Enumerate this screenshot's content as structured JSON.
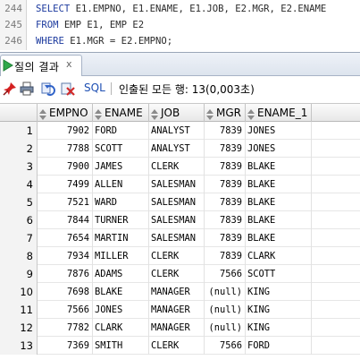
{
  "editor": {
    "lines": [
      {
        "no": "244",
        "parts": [
          {
            "t": "SELECT ",
            "c": "kw"
          },
          {
            "t": "E1.EMPNO, E1.ENAME, E1.JOB, E2.MGR, E2.ENAME",
            "c": "id"
          }
        ]
      },
      {
        "no": "245",
        "parts": [
          {
            "t": "FROM ",
            "c": "kw"
          },
          {
            "t": "EMP E1, EMP E2",
            "c": "id"
          }
        ]
      },
      {
        "no": "246",
        "parts": [
          {
            "t": "WHERE ",
            "c": "kw"
          },
          {
            "t": "E1.MGR = E2.EMPNO;",
            "c": "id"
          }
        ]
      }
    ]
  },
  "results": {
    "tab_label": "질의 결과",
    "tab_close": "x",
    "toolbar": {
      "sql_label": "SQL",
      "status_text": "인출된 모든 행: 13(0,003초)"
    },
    "columns": [
      "EMPNO",
      "ENAME",
      "JOB",
      "MGR",
      "ENAME_1"
    ],
    "rows": [
      {
        "n": "1",
        "empno": "7902",
        "ename": "FORD",
        "job": "ANALYST",
        "mgr": "7839",
        "ename_1": "JONES"
      },
      {
        "n": "2",
        "empno": "7788",
        "ename": "SCOTT",
        "job": "ANALYST",
        "mgr": "7839",
        "ename_1": "JONES"
      },
      {
        "n": "3",
        "empno": "7900",
        "ename": "JAMES",
        "job": "CLERK",
        "mgr": "7839",
        "ename_1": "BLAKE"
      },
      {
        "n": "4",
        "empno": "7499",
        "ename": "ALLEN",
        "job": "SALESMAN",
        "mgr": "7839",
        "ename_1": "BLAKE"
      },
      {
        "n": "5",
        "empno": "7521",
        "ename": "WARD",
        "job": "SALESMAN",
        "mgr": "7839",
        "ename_1": "BLAKE"
      },
      {
        "n": "6",
        "empno": "7844",
        "ename": "TURNER",
        "job": "SALESMAN",
        "mgr": "7839",
        "ename_1": "BLAKE"
      },
      {
        "n": "7",
        "empno": "7654",
        "ename": "MARTIN",
        "job": "SALESMAN",
        "mgr": "7839",
        "ename_1": "BLAKE"
      },
      {
        "n": "8",
        "empno": "7934",
        "ename": "MILLER",
        "job": "CLERK",
        "mgr": "7839",
        "ename_1": "CLARK"
      },
      {
        "n": "9",
        "empno": "7876",
        "ename": "ADAMS",
        "job": "CLERK",
        "mgr": "7566",
        "ename_1": "SCOTT"
      },
      {
        "n": "10",
        "empno": "7698",
        "ename": "BLAKE",
        "job": "MANAGER",
        "mgr": "(null)",
        "ename_1": "KING"
      },
      {
        "n": "11",
        "empno": "7566",
        "ename": "JONES",
        "job": "MANAGER",
        "mgr": "(null)",
        "ename_1": "KING"
      },
      {
        "n": "12",
        "empno": "7782",
        "ename": "CLARK",
        "job": "MANAGER",
        "mgr": "(null)",
        "ename_1": "KING"
      },
      {
        "n": "13",
        "empno": "7369",
        "ename": "SMITH",
        "job": "CLERK",
        "mgr": "7566",
        "ename_1": "FORD"
      }
    ]
  },
  "icons": {
    "tab_icon": "play-triangle-icon",
    "toolbar": [
      "pin-icon",
      "print-icon",
      "refresh-icon",
      "cancel-query-icon"
    ]
  },
  "colors": {
    "keyword": "#1c3a9e",
    "tab_icon": "#2fa84a",
    "sql_link": "#1e4fb3",
    "pin": "#d42020"
  }
}
